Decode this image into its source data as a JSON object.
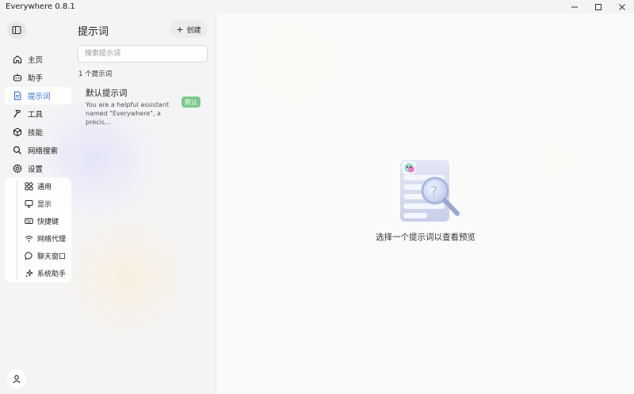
{
  "window": {
    "title": "Everywhere 0.8.1",
    "controls": [
      "minimize",
      "maximize",
      "close"
    ]
  },
  "nav": {
    "items": [
      {
        "label": "主页",
        "icon": "home-icon"
      },
      {
        "label": "助手",
        "icon": "robot-icon"
      },
      {
        "label": "提示词",
        "icon": "document-icon",
        "active": true
      },
      {
        "label": "工具",
        "icon": "hammer-icon"
      },
      {
        "label": "技能",
        "icon": "cube-icon"
      },
      {
        "label": "网络搜索",
        "icon": "search-icon"
      },
      {
        "label": "设置",
        "icon": "gear-icon"
      }
    ],
    "settings_sub": [
      {
        "label": "通用",
        "icon": "grid-icon"
      },
      {
        "label": "显示",
        "icon": "monitor-icon"
      },
      {
        "label": "快捷键",
        "icon": "keyboard-icon"
      },
      {
        "label": "网络代理",
        "icon": "wifi-icon"
      },
      {
        "label": "聊天窗口",
        "icon": "chat-icon"
      },
      {
        "label": "系统助手",
        "icon": "sparkle-icon"
      }
    ]
  },
  "prompts": {
    "title": "提示词",
    "create_label": "创建",
    "search_placeholder": "搜索提示词",
    "count_label": "1 个提示词",
    "items": [
      {
        "name": "默认提示词",
        "description": "You are a helpful assistant named \"Everywhere\", a precis...",
        "badge": "默认"
      }
    ]
  },
  "detail": {
    "empty_text": "选择一个提示词以查看预览"
  },
  "colors": {
    "accent": "#2f6ee0",
    "badge": "#7dc98a"
  }
}
